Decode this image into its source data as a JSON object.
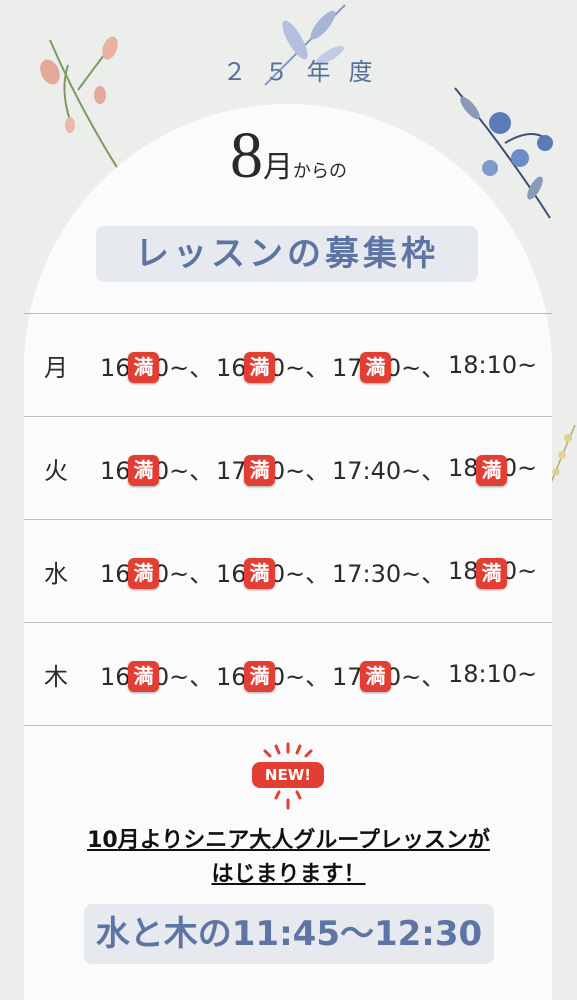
{
  "header": {
    "year": "２５年度",
    "month_number": "8",
    "month_kanji": "月",
    "from_text": "からの",
    "title": "レッスンの募集枠"
  },
  "schedule": [
    {
      "day": "月",
      "slots": [
        {
          "time": "16:10~、",
          "full": true
        },
        {
          "time": "16:50~、",
          "full": true
        },
        {
          "time": "17:30~、",
          "full": true
        },
        {
          "time": "18:10~",
          "full": false
        }
      ]
    },
    {
      "day": "火",
      "slots": [
        {
          "time": "16:20~、",
          "full": true
        },
        {
          "time": "17:00~、",
          "full": true
        },
        {
          "time": "17:40~、",
          "full": false
        },
        {
          "time": "18:20~",
          "full": true
        }
      ]
    },
    {
      "day": "水",
      "slots": [
        {
          "time": "16:10~、",
          "full": true
        },
        {
          "time": "16:50~、",
          "full": true
        },
        {
          "time": "17:30~、",
          "full": false
        },
        {
          "time": "18:10~",
          "full": true
        }
      ]
    },
    {
      "day": "木",
      "slots": [
        {
          "time": "16:10~、",
          "full": true
        },
        {
          "time": "16:50~、",
          "full": true
        },
        {
          "time": "17:30~、",
          "full": true
        },
        {
          "time": "18:10~",
          "full": false
        }
      ]
    }
  ],
  "full_badge": "満",
  "new_badge": "NEW!",
  "notice": {
    "line1": "10月よりシニア大人グループレッスンが",
    "line2": "はじまります！",
    "schedule": "水と木の11:45～12:30"
  },
  "colors": {
    "accent": "#5e74a4",
    "badge_red": "#e23e33",
    "background": "#eceeec"
  }
}
